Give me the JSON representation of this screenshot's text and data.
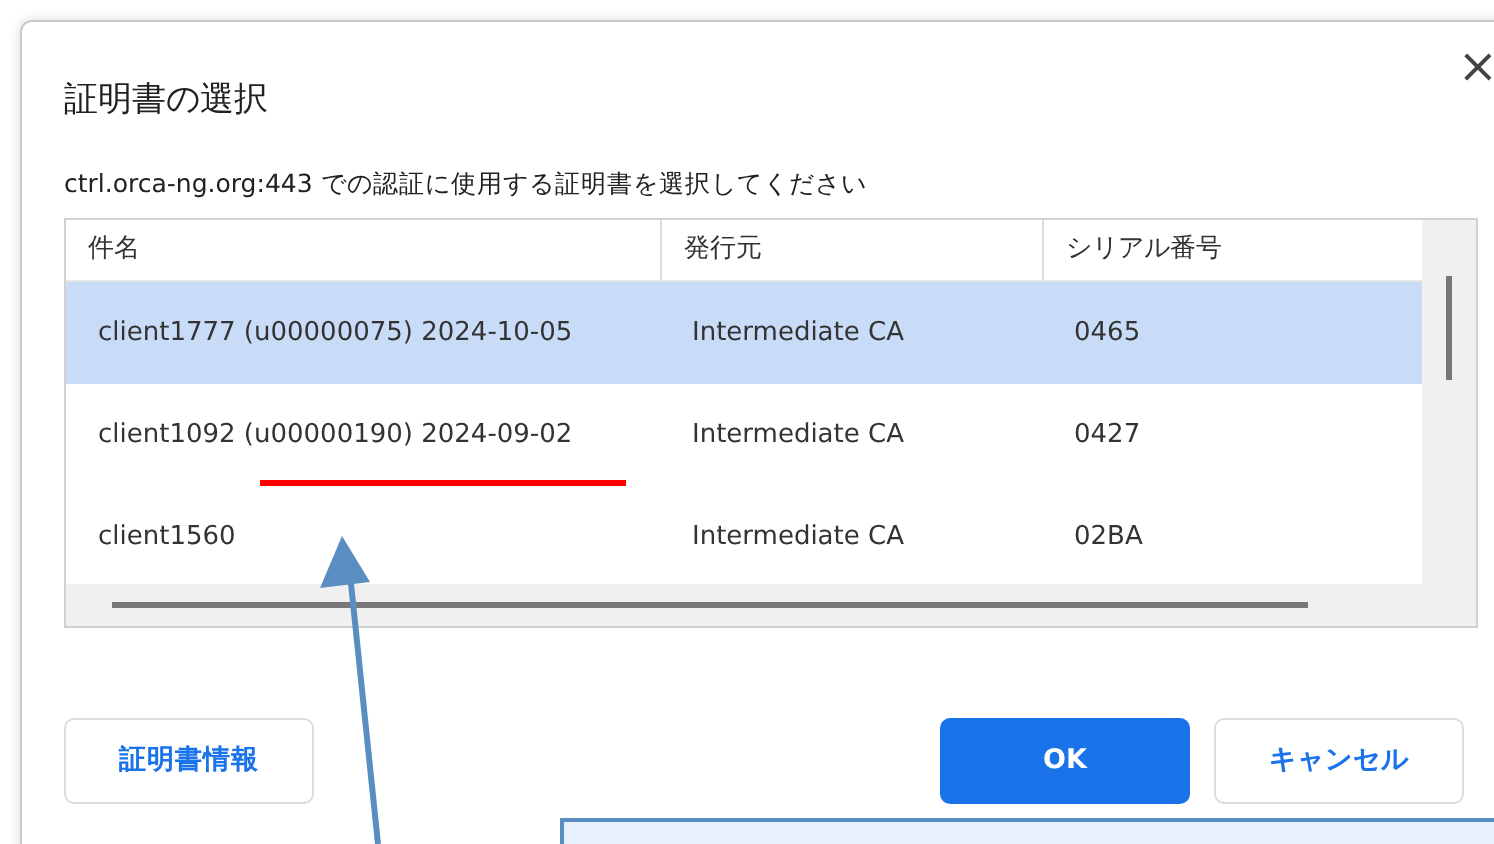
{
  "dialog": {
    "title": "証明書の選択",
    "close": "×",
    "message": "ctrl.orca-ng.org:443 での認証に使用する証明書を選択してください"
  },
  "table": {
    "columns": [
      "件名",
      "発行元",
      "シリアル番号"
    ],
    "rows": [
      {
        "cells": [
          "client1777 (u00000075) 2024-10-05",
          "Intermediate CA",
          "0465"
        ],
        "selected": true
      },
      {
        "cells": [
          "client1092 (u00000190) 2024-09-02",
          "Intermediate CA",
          "0427"
        ],
        "selected": false
      },
      {
        "cells": [
          "client1560",
          "Intermediate CA",
          "02BA"
        ],
        "selected": false
      }
    ]
  },
  "buttons": [
    {
      "label": "証明書情報",
      "kind": "secondary"
    },
    {
      "label": "OK",
      "kind": "primary"
    },
    {
      "label": "キャンセル",
      "kind": "secondary"
    }
  ],
  "annotations": [
    {
      "kind": "underline"
    },
    {
      "kind": "arrow"
    },
    {
      "kind": "callout"
    }
  ]
}
